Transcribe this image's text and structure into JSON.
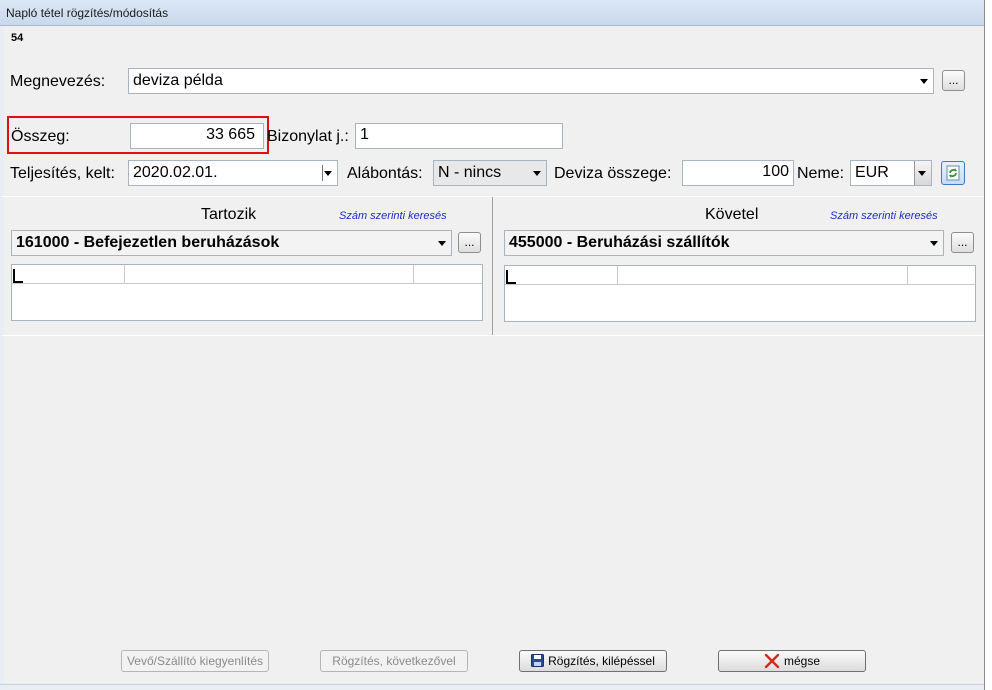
{
  "window": {
    "title": "Napló tétel rögzítés/módosítás"
  },
  "record_number": "54",
  "form": {
    "megnevezes_label": "Megnevezés:",
    "megnevezes_value": "deviza példa",
    "osszeg_label": "Összeg:",
    "osszeg_value": "33 665",
    "bizonylat_label": "Bizonylat j.:",
    "bizonylat_value": "1",
    "teljesites_label": "Teljesítés, kelt:",
    "teljesites_value": "2020.02.01.",
    "alabontas_label": "Alábontás:",
    "alabontas_value": "N - nincs",
    "deviza_osszeg_label": "Deviza összege:",
    "deviza_osszeg_value": "100",
    "neme_label": "Neme:",
    "neme_value": "EUR",
    "ellipsis": "..."
  },
  "tartozik": {
    "title": "Tartozik",
    "search_link": "Szám szerinti keresés",
    "account": "161000 - Befejezetlen beruházások"
  },
  "kovetel": {
    "title": "Követel",
    "search_link": "Szám szerinti keresés",
    "account": "455000 - Beruházási szállítók"
  },
  "buttons": {
    "vevo": "Vevő/Szállító kiegyenlítés",
    "rogzites_kov": "Rögzítés, következővel",
    "rogzites_kilep": "Rögzítés, kilépéssel",
    "megse": "mégse"
  },
  "colors": {
    "highlight": "#e01010",
    "link": "#1e2cc8"
  }
}
